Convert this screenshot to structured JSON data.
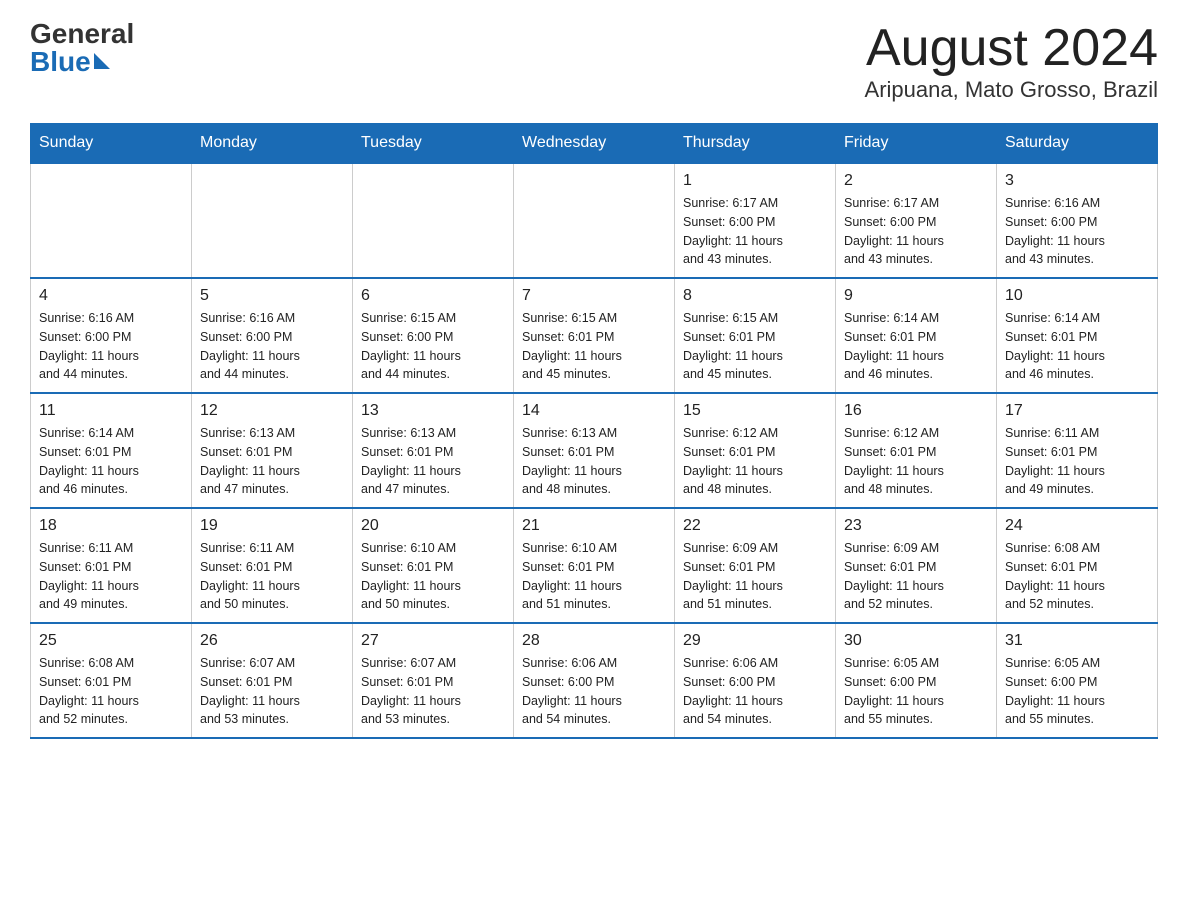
{
  "header": {
    "logo_general": "General",
    "logo_blue": "Blue",
    "month_title": "August 2024",
    "location": "Aripuana, Mato Grosso, Brazil"
  },
  "weekdays": [
    "Sunday",
    "Monday",
    "Tuesday",
    "Wednesday",
    "Thursday",
    "Friday",
    "Saturday"
  ],
  "weeks": [
    [
      {
        "day": "",
        "info": ""
      },
      {
        "day": "",
        "info": ""
      },
      {
        "day": "",
        "info": ""
      },
      {
        "day": "",
        "info": ""
      },
      {
        "day": "1",
        "info": "Sunrise: 6:17 AM\nSunset: 6:00 PM\nDaylight: 11 hours\nand 43 minutes."
      },
      {
        "day": "2",
        "info": "Sunrise: 6:17 AM\nSunset: 6:00 PM\nDaylight: 11 hours\nand 43 minutes."
      },
      {
        "day": "3",
        "info": "Sunrise: 6:16 AM\nSunset: 6:00 PM\nDaylight: 11 hours\nand 43 minutes."
      }
    ],
    [
      {
        "day": "4",
        "info": "Sunrise: 6:16 AM\nSunset: 6:00 PM\nDaylight: 11 hours\nand 44 minutes."
      },
      {
        "day": "5",
        "info": "Sunrise: 6:16 AM\nSunset: 6:00 PM\nDaylight: 11 hours\nand 44 minutes."
      },
      {
        "day": "6",
        "info": "Sunrise: 6:15 AM\nSunset: 6:00 PM\nDaylight: 11 hours\nand 44 minutes."
      },
      {
        "day": "7",
        "info": "Sunrise: 6:15 AM\nSunset: 6:01 PM\nDaylight: 11 hours\nand 45 minutes."
      },
      {
        "day": "8",
        "info": "Sunrise: 6:15 AM\nSunset: 6:01 PM\nDaylight: 11 hours\nand 45 minutes."
      },
      {
        "day": "9",
        "info": "Sunrise: 6:14 AM\nSunset: 6:01 PM\nDaylight: 11 hours\nand 46 minutes."
      },
      {
        "day": "10",
        "info": "Sunrise: 6:14 AM\nSunset: 6:01 PM\nDaylight: 11 hours\nand 46 minutes."
      }
    ],
    [
      {
        "day": "11",
        "info": "Sunrise: 6:14 AM\nSunset: 6:01 PM\nDaylight: 11 hours\nand 46 minutes."
      },
      {
        "day": "12",
        "info": "Sunrise: 6:13 AM\nSunset: 6:01 PM\nDaylight: 11 hours\nand 47 minutes."
      },
      {
        "day": "13",
        "info": "Sunrise: 6:13 AM\nSunset: 6:01 PM\nDaylight: 11 hours\nand 47 minutes."
      },
      {
        "day": "14",
        "info": "Sunrise: 6:13 AM\nSunset: 6:01 PM\nDaylight: 11 hours\nand 48 minutes."
      },
      {
        "day": "15",
        "info": "Sunrise: 6:12 AM\nSunset: 6:01 PM\nDaylight: 11 hours\nand 48 minutes."
      },
      {
        "day": "16",
        "info": "Sunrise: 6:12 AM\nSunset: 6:01 PM\nDaylight: 11 hours\nand 48 minutes."
      },
      {
        "day": "17",
        "info": "Sunrise: 6:11 AM\nSunset: 6:01 PM\nDaylight: 11 hours\nand 49 minutes."
      }
    ],
    [
      {
        "day": "18",
        "info": "Sunrise: 6:11 AM\nSunset: 6:01 PM\nDaylight: 11 hours\nand 49 minutes."
      },
      {
        "day": "19",
        "info": "Sunrise: 6:11 AM\nSunset: 6:01 PM\nDaylight: 11 hours\nand 50 minutes."
      },
      {
        "day": "20",
        "info": "Sunrise: 6:10 AM\nSunset: 6:01 PM\nDaylight: 11 hours\nand 50 minutes."
      },
      {
        "day": "21",
        "info": "Sunrise: 6:10 AM\nSunset: 6:01 PM\nDaylight: 11 hours\nand 51 minutes."
      },
      {
        "day": "22",
        "info": "Sunrise: 6:09 AM\nSunset: 6:01 PM\nDaylight: 11 hours\nand 51 minutes."
      },
      {
        "day": "23",
        "info": "Sunrise: 6:09 AM\nSunset: 6:01 PM\nDaylight: 11 hours\nand 52 minutes."
      },
      {
        "day": "24",
        "info": "Sunrise: 6:08 AM\nSunset: 6:01 PM\nDaylight: 11 hours\nand 52 minutes."
      }
    ],
    [
      {
        "day": "25",
        "info": "Sunrise: 6:08 AM\nSunset: 6:01 PM\nDaylight: 11 hours\nand 52 minutes."
      },
      {
        "day": "26",
        "info": "Sunrise: 6:07 AM\nSunset: 6:01 PM\nDaylight: 11 hours\nand 53 minutes."
      },
      {
        "day": "27",
        "info": "Sunrise: 6:07 AM\nSunset: 6:01 PM\nDaylight: 11 hours\nand 53 minutes."
      },
      {
        "day": "28",
        "info": "Sunrise: 6:06 AM\nSunset: 6:00 PM\nDaylight: 11 hours\nand 54 minutes."
      },
      {
        "day": "29",
        "info": "Sunrise: 6:06 AM\nSunset: 6:00 PM\nDaylight: 11 hours\nand 54 minutes."
      },
      {
        "day": "30",
        "info": "Sunrise: 6:05 AM\nSunset: 6:00 PM\nDaylight: 11 hours\nand 55 minutes."
      },
      {
        "day": "31",
        "info": "Sunrise: 6:05 AM\nSunset: 6:00 PM\nDaylight: 11 hours\nand 55 minutes."
      }
    ]
  ]
}
